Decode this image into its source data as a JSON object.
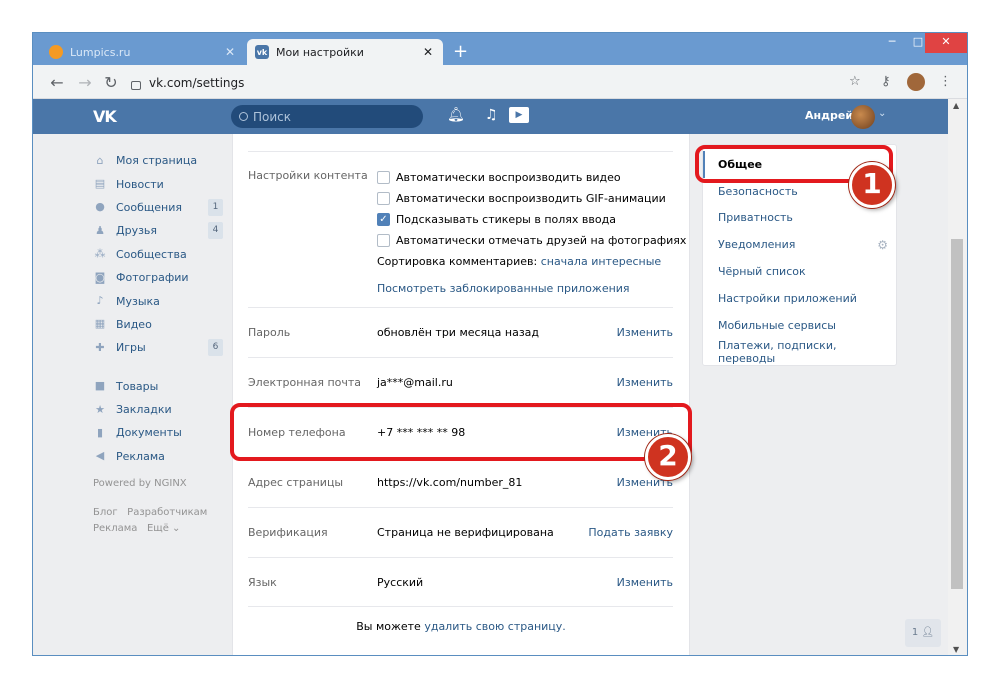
{
  "browser": {
    "tabs": [
      {
        "title": "Lumpics.ru",
        "active": false
      },
      {
        "title": "Мои настройки",
        "active": true
      }
    ],
    "new_tab": "+",
    "url": "vk.com/settings"
  },
  "vk": {
    "search_placeholder": "Поиск",
    "user_name": "Андрей",
    "left_nav": [
      {
        "label": "Моя страница",
        "icon": "home-icon"
      },
      {
        "label": "Новости",
        "icon": "news-icon"
      },
      {
        "label": "Сообщения",
        "icon": "messages-icon",
        "count": "1"
      },
      {
        "label": "Друзья",
        "icon": "friends-icon",
        "count": "4"
      },
      {
        "label": "Сообщества",
        "icon": "groups-icon"
      },
      {
        "label": "Фотографии",
        "icon": "camera-icon"
      },
      {
        "label": "Музыка",
        "icon": "music-icon"
      },
      {
        "label": "Видео",
        "icon": "video-icon"
      },
      {
        "label": "Игры",
        "icon": "gamepad-icon",
        "count": "6"
      },
      {
        "label": "Товары",
        "icon": "bag-icon"
      },
      {
        "label": "Закладки",
        "icon": "star-icon"
      },
      {
        "label": "Документы",
        "icon": "document-icon"
      },
      {
        "label": "Реклама",
        "icon": "megaphone-icon"
      }
    ],
    "powered_by": "Powered by NGINX",
    "footer_links": [
      "Блог",
      "Разработчикам",
      "Реклама",
      "Ещё ⌄"
    ]
  },
  "settings": {
    "content_label": "Настройки контента",
    "checkboxes": [
      {
        "label": "Автоматически воспроизводить видео",
        "checked": false
      },
      {
        "label": "Автоматически воспроизводить GIF-анимации",
        "checked": false
      },
      {
        "label": "Подсказывать стикеры в полях ввода",
        "checked": true
      },
      {
        "label": "Автоматически отмечать друзей на фотографиях",
        "checked": false
      }
    ],
    "sort_prefix": "Сортировка комментариев:",
    "sort_value": "сначала интересные",
    "blocked_apps": "Посмотреть заблокированные приложения",
    "rows": [
      {
        "label": "Пароль",
        "value": "обновлён три месяца назад",
        "action": "Изменить"
      },
      {
        "label": "Электронная почта",
        "value": "ja***@mail.ru",
        "action": "Изменить"
      },
      {
        "label": "Номер телефона",
        "value": "+7 *** *** ** 98",
        "action": "Изменить"
      },
      {
        "label": "Адрес страницы",
        "value": "https://vk.com/number_81",
        "action": "Изменить"
      },
      {
        "label": "Верификация",
        "value": "Страница не верифицирована",
        "action": "Подать заявку"
      },
      {
        "label": "Язык",
        "value": "Русский",
        "action": "Изменить"
      }
    ],
    "footer_prefix": "Вы можете",
    "footer_link": "удалить свою страницу."
  },
  "right_menu": [
    {
      "label": "Общее",
      "selected": true
    },
    {
      "label": "Безопасность",
      "selected": false
    },
    {
      "label": "Приватность",
      "selected": false
    },
    {
      "label": "Уведомления",
      "selected": false
    },
    {
      "label": "Чёрный список",
      "selected": false
    },
    {
      "label": "Настройки приложений",
      "selected": false
    },
    {
      "label": "Мобильные сервисы",
      "selected": false
    },
    {
      "label": "Платежи, подписки, переводы",
      "selected": false
    }
  ],
  "chat_count": "1",
  "annotations": {
    "badge1": "1",
    "badge2": "2"
  },
  "colors": {
    "vk_blue": "#4a76a8",
    "highlight_red": "#e3191e",
    "link": "#2a5885"
  }
}
